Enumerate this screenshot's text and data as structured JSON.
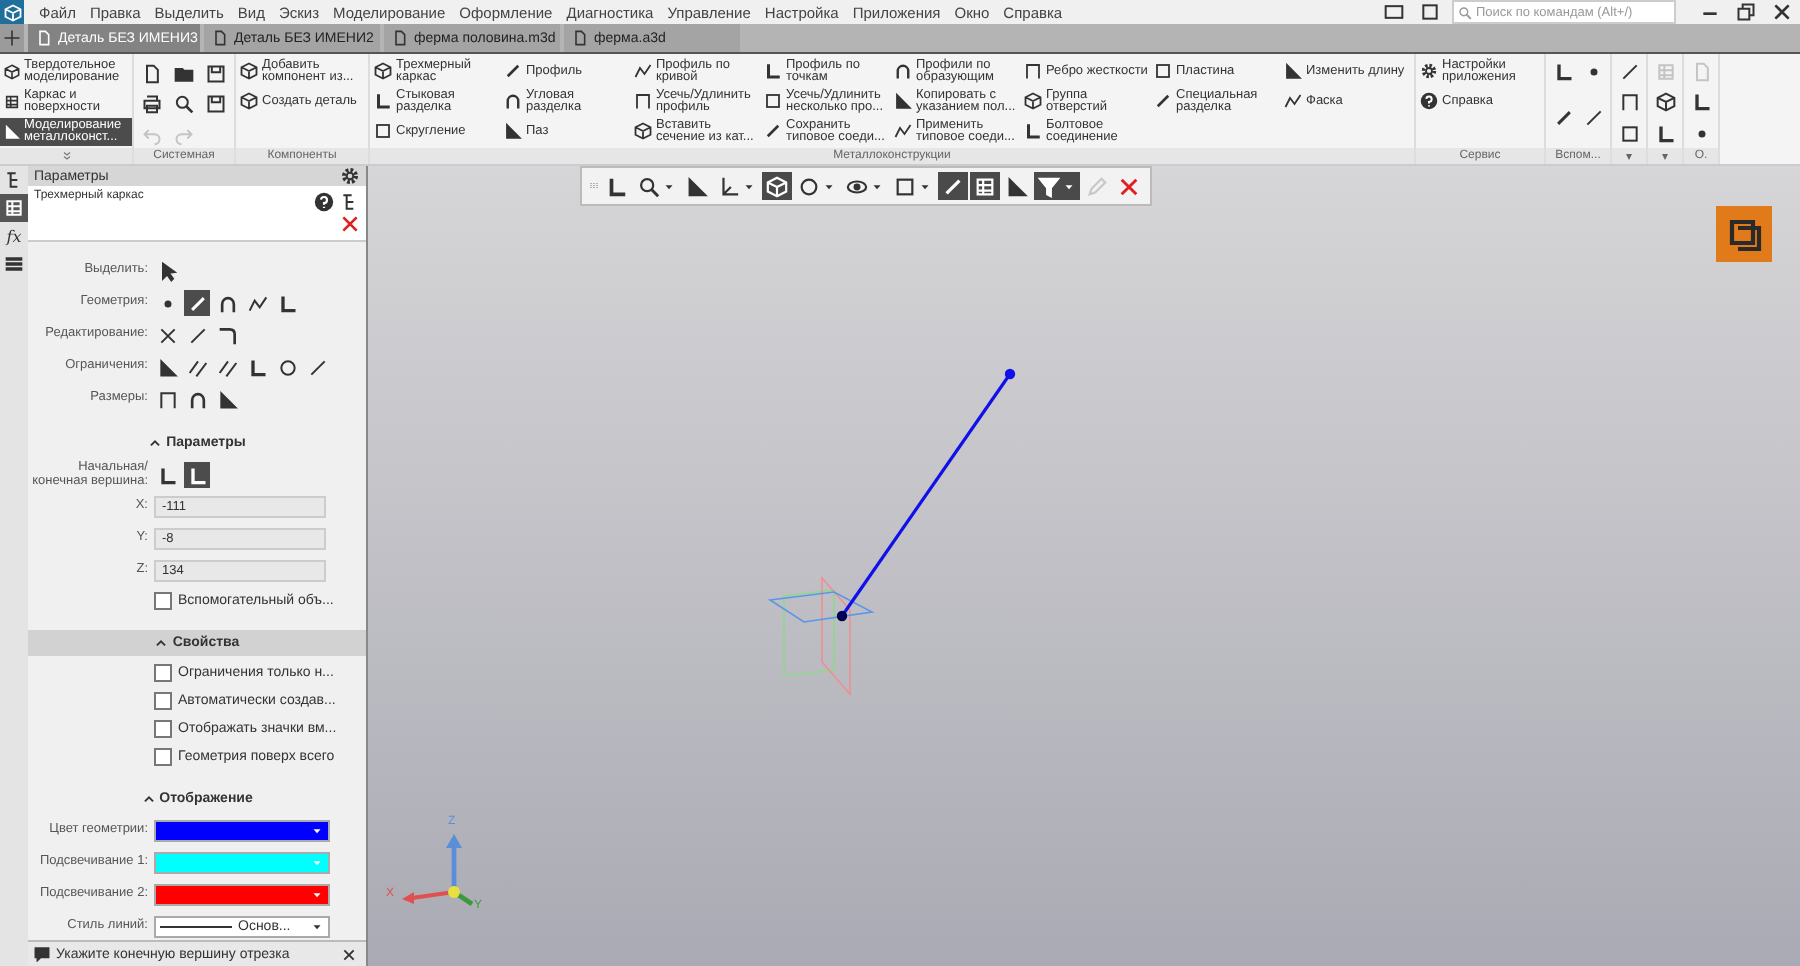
{
  "menu": [
    "Файл",
    "Правка",
    "Выделить",
    "Вид",
    "Эскиз",
    "Моделирование",
    "Оформление",
    "Диагностика",
    "Управление",
    "Настройка",
    "Приложения",
    "Окно",
    "Справка"
  ],
  "search": {
    "placeholder": "Поиск по командам (Alt+/)"
  },
  "tabs": [
    {
      "label": "Деталь БЕЗ ИМЕНИ3",
      "selected": true
    },
    {
      "label": "Деталь БЕЗ ИМЕНИ2",
      "selected": false
    },
    {
      "label": "ферма половина.m3d",
      "selected": false
    },
    {
      "label": "ферма.a3d",
      "selected": false
    }
  ],
  "ribbon": {
    "modes": [
      {
        "label": "Твердотельное моделирование",
        "selected": false
      },
      {
        "label": "Каркас и поверхности",
        "selected": false
      },
      {
        "label": "Моделирование металлоконст...",
        "selected": true
      }
    ],
    "system": {
      "title": "Системная",
      "undo": {
        "disabled": true
      },
      "redo": {
        "disabled": true
      }
    },
    "components": {
      "title": "Компоненты",
      "commands": [
        "Добавить компонент из...",
        "Создать деталь"
      ]
    },
    "metal": {
      "title": "Металлоконструкции",
      "columns": [
        [
          "Трехмерный каркас",
          "Стыковая разделка",
          "Скругление"
        ],
        [
          "Профиль",
          "Угловая разделка",
          "Паз"
        ],
        [
          "Профиль по кривой",
          "Усечь/Удлинить профиль",
          "Вставить сечение из кат..."
        ],
        [
          "Профиль по точкам",
          "Усечь/Удлинить несколько про...",
          "Сохранить типовое соеди..."
        ],
        [
          "Профили по образующим",
          "Копировать с указанием пол...",
          "Применить типовое соеди..."
        ],
        [
          "Ребро жесткости",
          "Группа отверстий",
          "Болтовое соединение"
        ],
        [
          "Пластина",
          "Специальная разделка"
        ],
        [
          "Изменить длину",
          "Фаска"
        ]
      ]
    },
    "service": {
      "title": "Сервис",
      "commands": [
        "Настройки приложения",
        "Справка"
      ]
    },
    "tool_groups": [
      {
        "title": "Вспом...",
        "icons": [
          {
            "disabled": false
          },
          {
            "disabled": false
          },
          {
            "disabled": false
          },
          {
            "disabled": false
          }
        ]
      },
      {
        "title": "▾",
        "icons": [
          {
            "disabled": false
          },
          {
            "disabled": false
          },
          {
            "disabled": false
          }
        ]
      },
      {
        "title": "▾",
        "icons": [
          {
            "disabled": true
          },
          {
            "disabled": false
          },
          {
            "disabled": false
          }
        ]
      },
      {
        "title": "О.",
        "icons": [
          {
            "disabled": true
          },
          {
            "disabled": false
          },
          {
            "disabled": false
          }
        ]
      }
    ]
  },
  "side_tabs": [
    {
      "selected": false
    },
    {
      "selected": true
    },
    {
      "label": "fx",
      "selected": false
    },
    {
      "selected": false
    }
  ],
  "panel": {
    "title": "Параметры",
    "subtitle": "Трехмерный каркас",
    "tool_rows": [
      {
        "label": "Выделить:",
        "buttons": [
          {
            "selected": false
          }
        ]
      },
      {
        "label": "Геометрия:",
        "buttons": [
          {
            "selected": false
          },
          {
            "selected": true
          },
          {
            "selected": false
          },
          {
            "selected": false
          },
          {
            "selected": false
          }
        ]
      },
      {
        "label": "Редактирование:",
        "buttons": [
          {
            "selected": false
          },
          {
            "selected": false
          },
          {
            "selected": false
          }
        ]
      },
      {
        "label": "Ограничения:",
        "buttons": [
          {
            "selected": false
          },
          {
            "selected": false
          },
          {
            "selected": false
          },
          {
            "selected": false
          },
          {
            "selected": false
          },
          {
            "selected": false
          }
        ]
      },
      {
        "label": "Размеры:",
        "buttons": [
          {
            "selected": false
          },
          {
            "selected": false
          },
          {
            "selected": false
          }
        ]
      }
    ],
    "sections": [
      {
        "title": "Параметры",
        "expanded": true,
        "highlighted": false,
        "vertex": {
          "label": "Начальная/ конечная вершина:",
          "buttons": [
            {
              "selected": false
            },
            {
              "selected": true
            }
          ]
        },
        "fields": [
          {
            "label": "X:",
            "value": "-111",
            "disabled": true
          },
          {
            "label": "Y:",
            "value": "-8",
            "disabled": true
          },
          {
            "label": "Z:",
            "value": "134",
            "disabled": true
          }
        ],
        "checkboxes": [
          {
            "label": "Вспомогательный объ...",
            "checked": false
          }
        ]
      },
      {
        "title": "Свойства",
        "expanded": true,
        "highlighted": true,
        "checkboxes": [
          {
            "label": "Ограничения только н...",
            "checked": false
          },
          {
            "label": "Автоматически создав...",
            "checked": false
          },
          {
            "label": "Отображать значки вм...",
            "checked": false
          },
          {
            "label": "Геометрия поверх всего",
            "checked": false
          }
        ]
      },
      {
        "title": "Отображение",
        "expanded": true,
        "highlighted": false,
        "colors": [
          {
            "label": "Цвет геометрии:",
            "color": "#0000ff"
          },
          {
            "label": "Подсвечивание 1:",
            "color": "#00ffff"
          },
          {
            "label": "Подсвечивание 2:",
            "color": "#ff0000"
          }
        ],
        "line_style": {
          "label": "Стиль линий:",
          "value": "Основ..."
        }
      }
    ]
  },
  "status": {
    "text": "Укажите конечную вершину отрезка"
  },
  "axis_labels": {
    "x": "X",
    "y": "Y",
    "z": "Z"
  },
  "view_toolbar": [
    {
      "selected": false,
      "dropdown": false,
      "disabled": false
    },
    {
      "selected": false,
      "dropdown": true,
      "disabled": false
    },
    {
      "selected": false,
      "dropdown": false,
      "disabled": false
    },
    {
      "selected": false,
      "dropdown": true,
      "disabled": false
    },
    {
      "selected": true,
      "dropdown": false,
      "disabled": false
    },
    {
      "selected": false,
      "dropdown": true,
      "disabled": false
    },
    {
      "selected": false,
      "dropdown": true,
      "disabled": false
    },
    {
      "selected": false,
      "dropdown": true,
      "disabled": false
    },
    {
      "selected": true,
      "dropdown": false,
      "disabled": false
    },
    {
      "selected": true,
      "dropdown": false,
      "disabled": false
    },
    {
      "selected": false,
      "dropdown": false,
      "disabled": false
    },
    {
      "selected": true,
      "dropdown": true,
      "disabled": false
    },
    {
      "selected": false,
      "dropdown": false,
      "disabled": true
    },
    {
      "selected": false,
      "dropdown": false,
      "disabled": false
    }
  ]
}
